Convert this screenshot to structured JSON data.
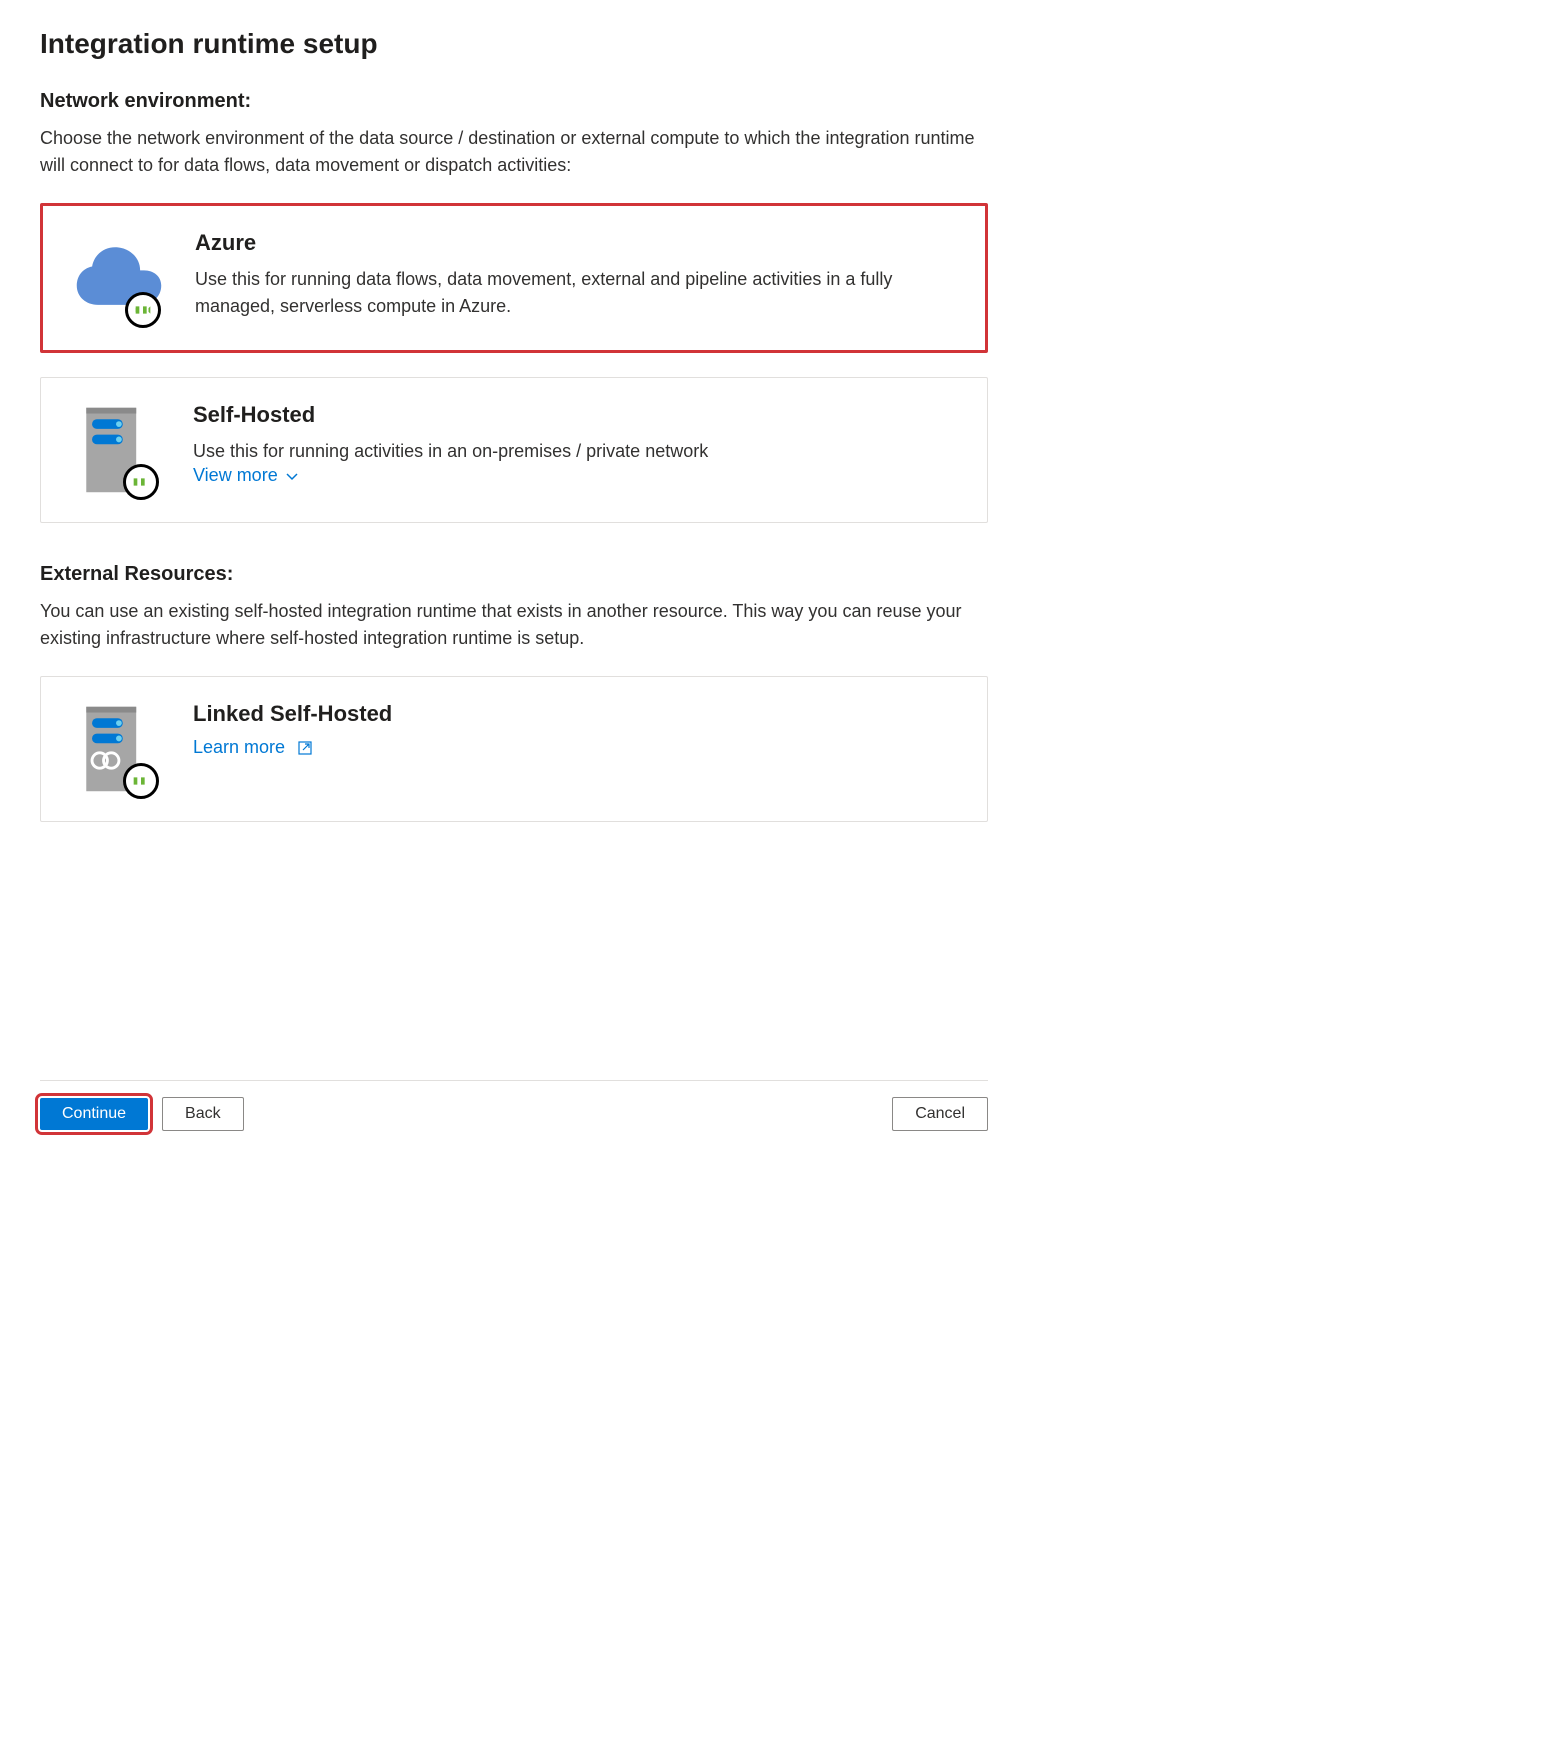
{
  "title": "Integration runtime setup",
  "network_section": {
    "heading": "Network environment:",
    "description": "Choose the network environment of the data source / destination or external compute to which the integration runtime will connect to for data flows, data movement or dispatch activities:"
  },
  "options": {
    "azure": {
      "title": "Azure",
      "description": "Use this for running data flows, data movement, external and pipeline activities in a fully managed, serverless compute in Azure."
    },
    "self_hosted": {
      "title": "Self-Hosted",
      "description": "Use this for running activities in an on-premises / private network",
      "view_more": "View more"
    }
  },
  "external_section": {
    "heading": "External Resources:",
    "description": "You can use an existing self-hosted integration runtime that exists in another resource. This way you can reuse your existing infrastructure where self-hosted integration runtime is setup."
  },
  "linked_option": {
    "title": "Linked Self-Hosted",
    "learn_more": "Learn more"
  },
  "footer": {
    "continue": "Continue",
    "back": "Back",
    "cancel": "Cancel"
  }
}
